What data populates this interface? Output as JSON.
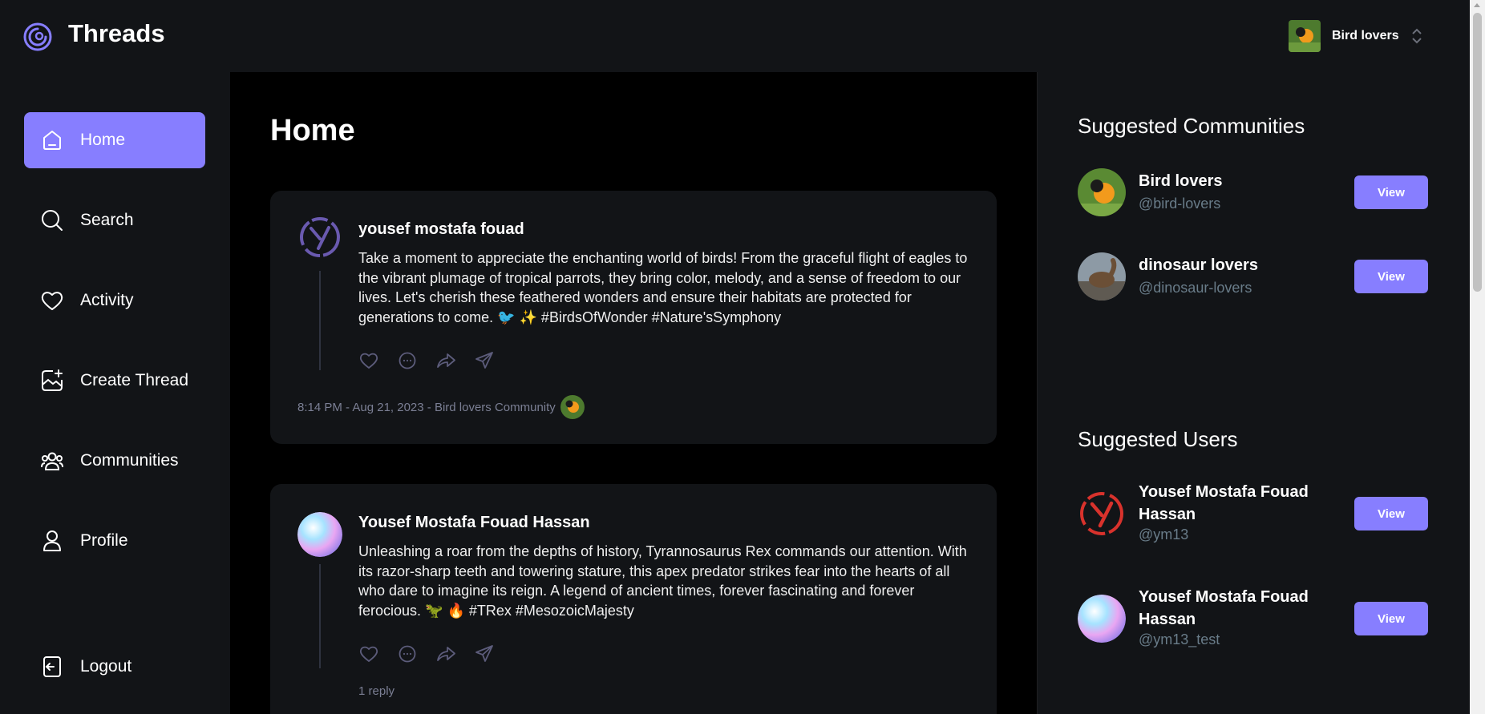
{
  "app": {
    "name": "Threads"
  },
  "org_switcher": {
    "name": "Bird lovers"
  },
  "sidebar": {
    "items": [
      {
        "label": "Home",
        "icon": "home-icon",
        "active": true
      },
      {
        "label": "Search",
        "icon": "search-icon"
      },
      {
        "label": "Activity",
        "icon": "heart-icon"
      },
      {
        "label": "Create Thread",
        "icon": "create-icon"
      },
      {
        "label": "Communities",
        "icon": "communities-icon"
      },
      {
        "label": "Profile",
        "icon": "user-icon"
      }
    ],
    "logout_label": "Logout"
  },
  "main": {
    "title": "Home",
    "threads": [
      {
        "author": "yousef mostafa fouad",
        "body": "Take a moment to appreciate the enchanting world of birds! From the graceful flight of eagles to the vibrant plumage of tropical parrots, they bring color, melody, and a sense of freedom to our lives. Let's cherish these feathered wonders and ensure their habitats are protected for generations to come. 🐦 ✨ #BirdsOfWonder #Nature'sSymphony",
        "meta": "8:14 PM - Aug 21, 2023 - Bird lovers Community"
      },
      {
        "author": "Yousef Mostafa Fouad Hassan",
        "body": "Unleashing a roar from the depths of history, Tyrannosaurus Rex commands our attention. With its razor-sharp teeth and towering stature, this apex predator strikes fear into the hearts of all who dare to imagine its reign. A legend of ancient times, forever fascinating and forever ferocious. 🦖 🔥 #TRex #MesozoicMajesty",
        "replies": "1 reply"
      }
    ]
  },
  "rightbar": {
    "communities_title": "Suggested Communities",
    "communities": [
      {
        "name": "Bird lovers",
        "handle": "@bird-lovers",
        "button": "View"
      },
      {
        "name": "dinosaur lovers",
        "handle": "@dinosaur-lovers",
        "button": "View"
      }
    ],
    "users_title": "Suggested Users",
    "users": [
      {
        "name": "Yousef Mostafa Fouad Hassan",
        "handle": "@ym13",
        "button": "View"
      },
      {
        "name": "Yousef Mostafa Fouad Hassan",
        "handle": "@ym13_test",
        "button": "View"
      }
    ]
  },
  "colors": {
    "accent": "#877eff",
    "sidebar_bg": "#121417",
    "main_bg": "#000000",
    "muted": "#697c89"
  }
}
